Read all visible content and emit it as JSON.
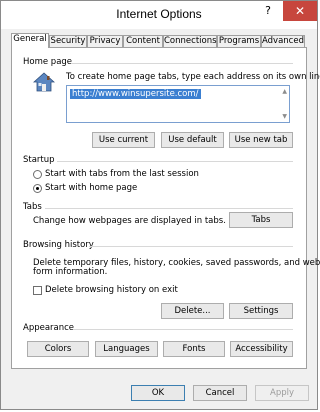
{
  "window": {
    "title": "Internet Options",
    "help_glyph": "?",
    "close_glyph": "✕"
  },
  "tabs": [
    {
      "label": "General",
      "active": true
    },
    {
      "label": "Security"
    },
    {
      "label": "Privacy"
    },
    {
      "label": "Content"
    },
    {
      "label": "Connections"
    },
    {
      "label": "Programs"
    },
    {
      "label": "Advanced"
    }
  ],
  "home_page": {
    "title": "Home page",
    "description": "To create home page tabs, type each address on its own line.",
    "url": "http://www.winsupersite.com/",
    "buttons": {
      "use_current": "Use current",
      "use_default": "Use default",
      "use_new_tab": "Use new tab"
    }
  },
  "startup": {
    "title": "Startup",
    "options": [
      {
        "label": "Start with tabs from the last session",
        "selected": false
      },
      {
        "label": "Start with home page",
        "selected": true
      }
    ]
  },
  "tabs_section": {
    "title": "Tabs",
    "description": "Change how webpages are displayed in tabs.",
    "button": "Tabs"
  },
  "browsing_history": {
    "title": "Browsing history",
    "description_line1": "Delete temporary files, history, cookies, saved passwords, and web",
    "description_line2": "form information.",
    "checkbox_label": "Delete browsing history on exit",
    "checkbox_checked": false,
    "delete_button": "Delete...",
    "settings_button": "Settings"
  },
  "appearance": {
    "title": "Appearance",
    "buttons": [
      "Colors",
      "Languages",
      "Fonts",
      "Accessibility"
    ]
  },
  "footer": {
    "ok": "OK",
    "cancel": "Cancel",
    "apply": "Apply"
  },
  "colors": {
    "accent": "#3b7fd1",
    "close_button": "#c7463d"
  }
}
